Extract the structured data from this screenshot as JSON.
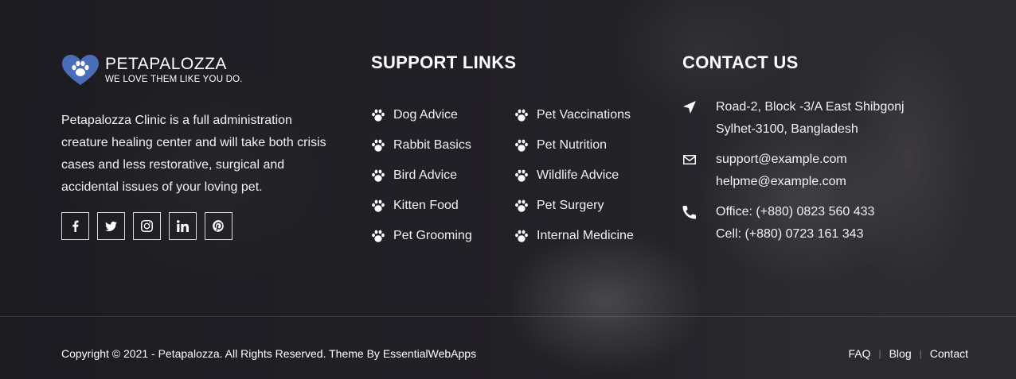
{
  "brand": {
    "name": "PETAPALOZZA",
    "tagline": "WE LOVE THEM LIKE YOU DO.",
    "logo_icon": "heart-paw-icon",
    "accent_color": "#4b6cb7"
  },
  "about": {
    "text": "Petapalozza Clinic is a full administration creature healing center and will take both crisis cases and less restorative, surgical and accidental issues of your loving pet."
  },
  "socials": [
    {
      "icon": "facebook-icon"
    },
    {
      "icon": "twitter-icon"
    },
    {
      "icon": "instagram-icon"
    },
    {
      "icon": "linkedin-icon"
    },
    {
      "icon": "pinterest-icon"
    }
  ],
  "support": {
    "heading": "SUPPORT LINKS",
    "left": [
      "Dog Advice",
      "Rabbit Basics",
      "Bird Advice",
      "Kitten Food",
      "Pet Grooming"
    ],
    "right": [
      "Pet Vaccinations",
      "Pet Nutrition",
      "Wildlife Advice",
      "Pet Surgery",
      "Internal Medicine"
    ]
  },
  "contact": {
    "heading": "CONTACT US",
    "address": [
      "Road-2, Block -3/A East Shibgonj",
      "Sylhet-3100, Bangladesh"
    ],
    "emails": [
      "support@example.com",
      "helpme@example.com"
    ],
    "phones": [
      "Office:  (+880) 0823 560 433",
      "Cell:  (+880) 0723 161 343"
    ]
  },
  "footer": {
    "copyright": "Copyright © 2021 - Petapalozza. All Rights Reserved. Theme By EssentialWebApps",
    "nav": [
      "FAQ",
      "Blog",
      "Contact"
    ]
  }
}
